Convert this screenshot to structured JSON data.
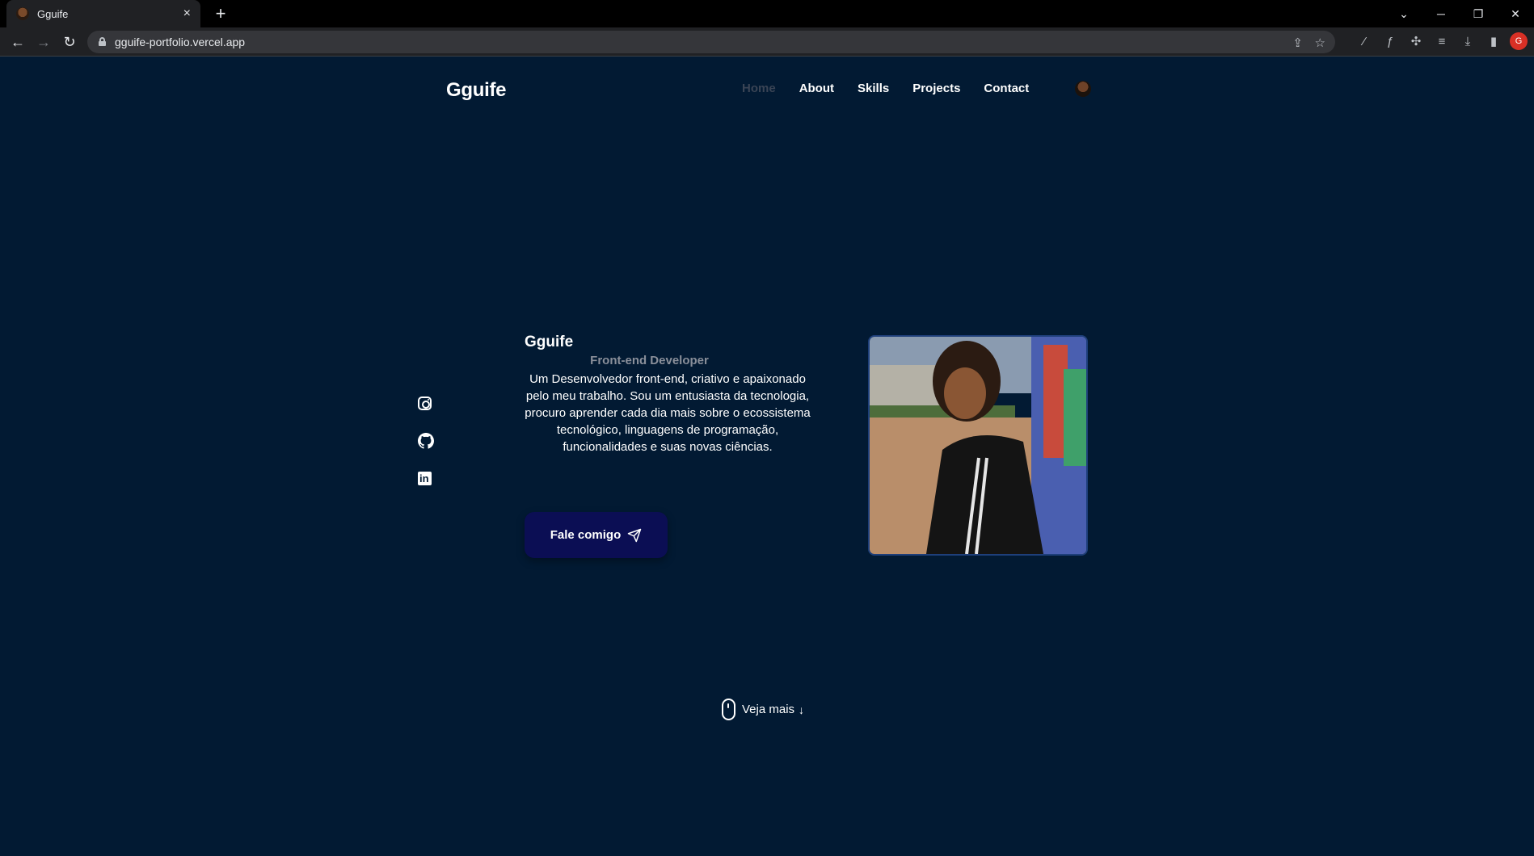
{
  "browser": {
    "tab_title": "Gguife",
    "tab_close": "×",
    "new_tab": "+",
    "url": "gguife-portfolio.vercel.app",
    "profile_initial": "G",
    "window_controls": {
      "chevron": "⌄",
      "minimize": "─",
      "restore": "❐",
      "close": "✕"
    },
    "nav_icons": {
      "back": "←",
      "forward": "→",
      "reload": "↻"
    },
    "icons": [
      "share-icon",
      "star-icon",
      "extension-icon",
      "formula-icon",
      "puzzle-icon",
      "media-icon",
      "download-icon",
      "sidepanel-icon"
    ]
  },
  "site": {
    "logo": "Gguife",
    "nav": {
      "home": "Home",
      "about": "About",
      "skills": "Skills",
      "projects": "Projects",
      "contact": "Contact"
    },
    "active_nav": "Home"
  },
  "hero": {
    "name": "Gguife",
    "role": "Front-end Developer",
    "description": "Um Desenvolvedor front-end, criativo e apaixonado pelo meu trabalho. Sou um entusiasta da tecnologia, procuro aprender cada dia mais sobre o ecossistema tecnológico, linguagens de programação, funcionalidades e suas novas ciências.",
    "cta_label": "Fale comigo"
  },
  "socials": [
    "instagram-icon",
    "github-icon",
    "linkedin-icon"
  ],
  "scroll_hint": {
    "label": "Veja mais",
    "arrow": "↓"
  },
  "colors": {
    "background": "#021a33",
    "button": "#0b0e54",
    "muted_text": "#8a8f9a",
    "photo_border": "#1e3f7a"
  }
}
